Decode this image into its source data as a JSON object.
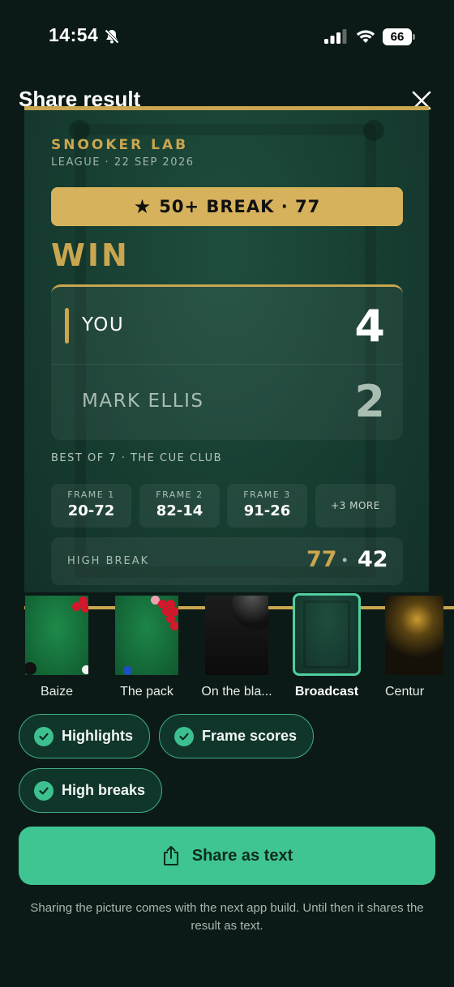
{
  "status_bar": {
    "time": "14:54",
    "battery": "66"
  },
  "header": {
    "title": "Share result"
  },
  "card": {
    "brand": "SNOOKER LAB",
    "league_date": "LEAGUE · 22 SEP 2026",
    "break_banner": "50+ BREAK · 77",
    "result": "WIN",
    "players": [
      {
        "name": "YOU",
        "score": "4"
      },
      {
        "name": "MARK ELLIS",
        "score": "2"
      }
    ],
    "format": "BEST OF 7 · THE CUE CLUB",
    "frames": [
      {
        "label": "FRAME 1",
        "score": "20-72"
      },
      {
        "label": "FRAME 2",
        "score": "82-14"
      },
      {
        "label": "FRAME 3",
        "score": "91-26"
      }
    ],
    "more_frames": "+3 MORE",
    "high_break": {
      "label": "HIGH BREAK",
      "you": "77",
      "opponent": "42"
    }
  },
  "themes": [
    {
      "label": "Baize",
      "selected": false
    },
    {
      "label": "The pack",
      "selected": false
    },
    {
      "label": "On the bla...",
      "selected": false
    },
    {
      "label": "Broadcast",
      "selected": true
    },
    {
      "label": "Centur",
      "selected": false
    }
  ],
  "options": [
    {
      "label": "Highlights",
      "checked": true
    },
    {
      "label": "Frame scores",
      "checked": true
    },
    {
      "label": "High breaks",
      "checked": true
    }
  ],
  "share_button": {
    "label": "Share as text"
  },
  "note": "Sharing the picture comes with the next app build. Until then it shares the result as text.",
  "colors": {
    "accent": "#3fc591",
    "gold": "#c9a64f",
    "background": "#0c1a17",
    "card": "#1a4536"
  }
}
